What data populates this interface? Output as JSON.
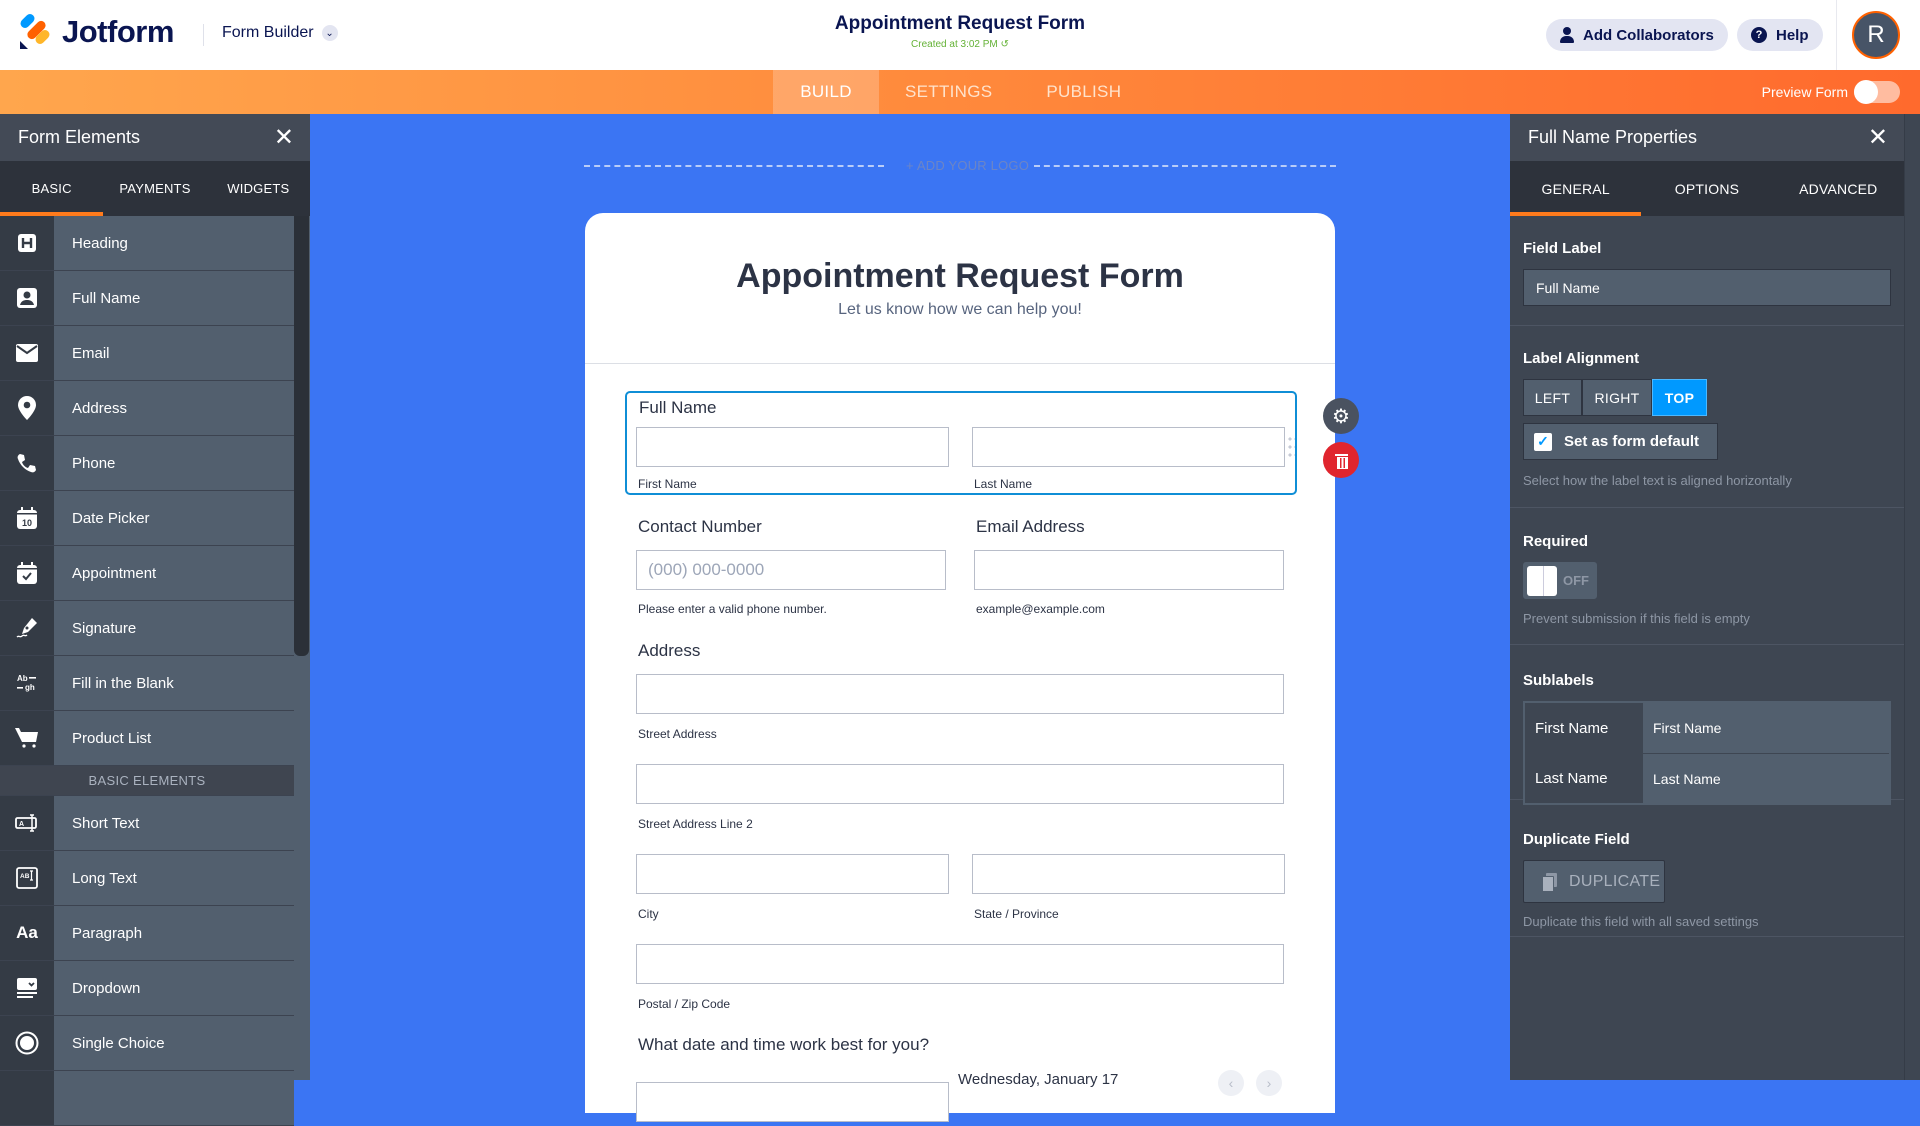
{
  "header": {
    "brand": "Jotform",
    "product_menu": "Form Builder",
    "form_title": "Appointment Request Form",
    "saved_status": "Created at 3:02 PM",
    "add_collaborators": "Add Collaborators",
    "help": "Help",
    "avatar_initial": "R",
    "accent_color": "#ff6100"
  },
  "nav": {
    "tabs": [
      {
        "label": "BUILD",
        "active": true
      },
      {
        "label": "SETTINGS",
        "active": false
      },
      {
        "label": "PUBLISH",
        "active": false
      }
    ],
    "preview_label": "Preview Form",
    "preview_on": false
  },
  "left_panel": {
    "title": "Form Elements",
    "tabs": [
      {
        "label": "BASIC",
        "active": true
      },
      {
        "label": "PAYMENTS",
        "active": false
      },
      {
        "label": "WIDGETS",
        "active": false
      }
    ],
    "items": [
      {
        "label": "Heading",
        "icon": "heading-icon"
      },
      {
        "label": "Full Name",
        "icon": "person-icon"
      },
      {
        "label": "Email",
        "icon": "envelope-icon"
      },
      {
        "label": "Address",
        "icon": "map-pin-icon"
      },
      {
        "label": "Phone",
        "icon": "phone-icon"
      },
      {
        "label": "Date Picker",
        "icon": "calendar-icon"
      },
      {
        "label": "Appointment",
        "icon": "calendar-check-icon"
      },
      {
        "label": "Signature",
        "icon": "pen-nib-icon"
      },
      {
        "label": "Fill in the Blank",
        "icon": "fill-blank-icon"
      },
      {
        "label": "Product List",
        "icon": "cart-icon"
      }
    ],
    "section_label": "BASIC ELEMENTS",
    "basic_items": [
      {
        "label": "Short Text",
        "icon": "short-text-icon"
      },
      {
        "label": "Long Text",
        "icon": "long-text-icon"
      },
      {
        "label": "Paragraph",
        "icon": "paragraph-icon"
      },
      {
        "label": "Dropdown",
        "icon": "dropdown-icon"
      },
      {
        "label": "Single Choice",
        "icon": "radio-icon"
      }
    ]
  },
  "canvas": {
    "add_logo": "+ ADD YOUR LOGO",
    "form_heading": "Appointment Request Form",
    "form_subheading": "Let us know how we can help you!",
    "full_name": {
      "label": "Full Name",
      "first_sub": "First Name",
      "last_sub": "Last Name"
    },
    "contact": {
      "label": "Contact Number",
      "placeholder": "(000) 000-0000",
      "hint": "Please enter a valid phone number."
    },
    "email": {
      "label": "Email Address",
      "hint": "example@example.com"
    },
    "address": {
      "label": "Address",
      "street": "Street Address",
      "street2": "Street Address Line 2",
      "city": "City",
      "state": "State / Province",
      "postal": "Postal / Zip Code"
    },
    "appointment": {
      "label": "What date and time work best for you?",
      "date_text": "Wednesday, January 17"
    }
  },
  "right_panel": {
    "title": "Full Name Properties",
    "tabs": [
      {
        "label": "GENERAL",
        "active": true
      },
      {
        "label": "OPTIONS",
        "active": false
      },
      {
        "label": "ADVANCED",
        "active": false
      }
    ],
    "field_label": {
      "heading": "Field Label",
      "value": "Full Name"
    },
    "label_alignment": {
      "heading": "Label Alignment",
      "options": [
        "LEFT",
        "RIGHT",
        "TOP"
      ],
      "selected": "TOP",
      "default_checkbox_label": "Set as form default",
      "default_checked": true,
      "hint": "Select how the label text is aligned horizontally"
    },
    "required": {
      "heading": "Required",
      "state": "OFF",
      "hint": "Prevent submission if this field is empty"
    },
    "sublabels": {
      "heading": "Sublabels",
      "rows": [
        {
          "key": "First Name",
          "value": "First Name"
        },
        {
          "key": "Last Name",
          "value": "Last Name"
        }
      ]
    },
    "duplicate": {
      "heading": "Duplicate Field",
      "button": "DUPLICATE",
      "hint": "Duplicate this field with all saved settings"
    }
  }
}
